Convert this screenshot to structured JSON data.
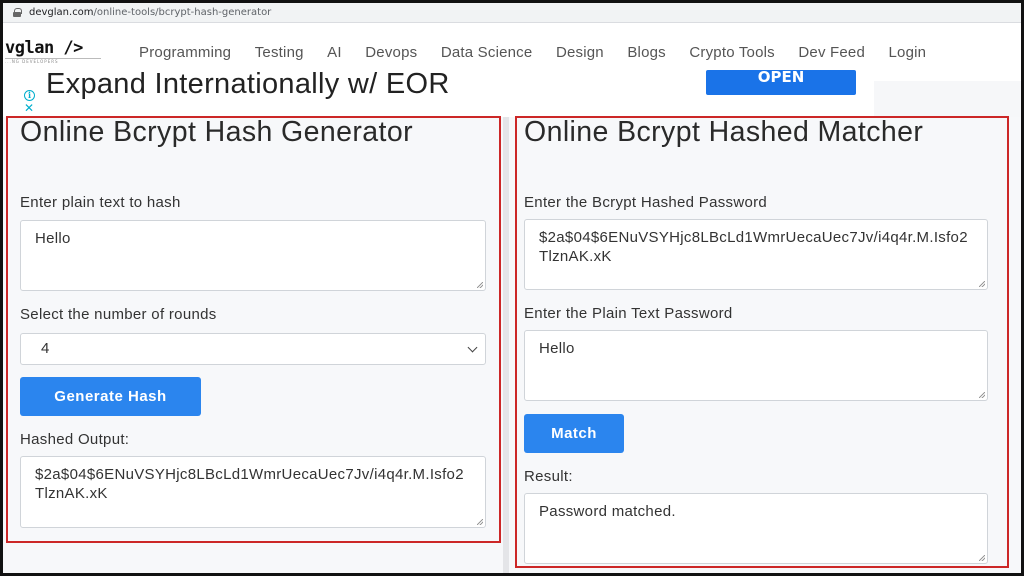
{
  "browser": {
    "url_host": "devglan.com",
    "url_path": "/online-tools/bcrypt-hash-generator"
  },
  "nav": {
    "logo": "vglan />",
    "logo_sub": "...NG DEVELOPERS",
    "links": [
      "Programming",
      "Testing",
      "AI",
      "Devops",
      "Data Science",
      "Design",
      "Blogs",
      "Crypto Tools",
      "Dev Feed",
      "Login"
    ]
  },
  "ad": {
    "headline": "Expand Internationally w/ EOR",
    "button": "OPEN",
    "info_icon": "i",
    "close_icon": "✕"
  },
  "generator": {
    "title": "Online Bcrypt Hash Generator",
    "plain_label": "Enter plain text to hash",
    "plain_value": "Hello",
    "rounds_label": "Select the number of rounds",
    "rounds_value": "4",
    "generate_button": "Generate Hash",
    "output_label": "Hashed Output:",
    "output_value": "$2a$04$6ENuVSYHjc8LBcLd1WmrUecaUec7Jv/i4q4r.M.Isfo2TlznAK.xK"
  },
  "matcher": {
    "title": "Online Bcrypt Hashed Matcher",
    "hash_label": "Enter the Bcrypt Hashed Password",
    "hash_value": "$2a$04$6ENuVSYHjc8LBcLd1WmrUecaUec7Jv/i4q4r.M.Isfo2TlznAK.xK",
    "plain_label": "Enter the Plain Text Password",
    "plain_value": "Hello",
    "match_button": "Match",
    "result_label": "Result:",
    "result_value": "Password matched."
  },
  "colors": {
    "highlight_border": "#cc2727",
    "primary_button": "#2b85ee"
  }
}
